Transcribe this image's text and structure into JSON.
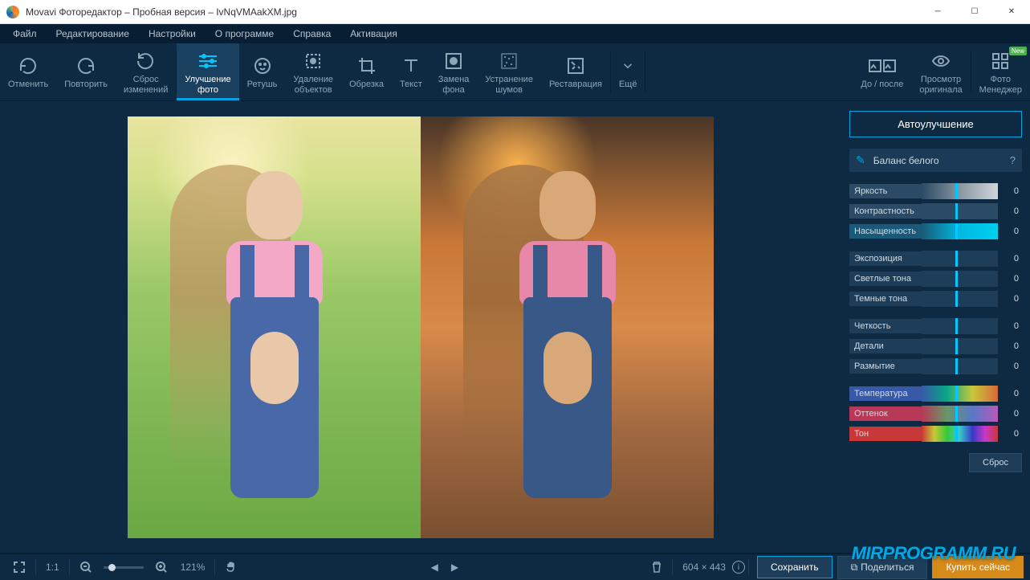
{
  "window": {
    "title": "Movavi Фоторедактор – Пробная версия – IvNqVMAakXM.jpg"
  },
  "menu": {
    "file": "Файл",
    "edit": "Редактирование",
    "settings": "Настройки",
    "about": "О программе",
    "help": "Справка",
    "activation": "Активация"
  },
  "toolbar": {
    "undo": "Отменить",
    "redo": "Повторить",
    "reset": "Сброс\nизменений",
    "enhance": "Улучшение\nфото",
    "retouch": "Ретушь",
    "remove": "Удаление\nобъектов",
    "crop": "Обрезка",
    "text": "Текст",
    "bg": "Замена\nфона",
    "noise": "Устранение\nшумов",
    "restore": "Реставрация",
    "more": "Ещё",
    "beforeafter": "До / после",
    "original": "Просмотр\nоригинала",
    "manager": "Фото\nМенеджер",
    "new_badge": "New"
  },
  "panel": {
    "auto": "Автоулучшение",
    "wb": "Баланс белого",
    "help": "?",
    "sliders": {
      "brightness": {
        "label": "Яркость",
        "value": "0"
      },
      "contrast": {
        "label": "Контрастность",
        "value": "0"
      },
      "saturation": {
        "label": "Насыщенность",
        "value": "0"
      },
      "exposure": {
        "label": "Экспозиция",
        "value": "0"
      },
      "highlights": {
        "label": "Светлые тона",
        "value": "0"
      },
      "shadows": {
        "label": "Темные тона",
        "value": "0"
      },
      "sharpness": {
        "label": "Четкость",
        "value": "0"
      },
      "details": {
        "label": "Детали",
        "value": "0"
      },
      "blur": {
        "label": "Размытие",
        "value": "0"
      },
      "temperature": {
        "label": "Температура",
        "value": "0"
      },
      "tint": {
        "label": "Оттенок",
        "value": "0"
      },
      "hue": {
        "label": "Тон",
        "value": "0"
      }
    },
    "reset": "Сброс"
  },
  "bottom": {
    "fit": "1:1",
    "zoom": "121%",
    "dimensions": "604 × 443",
    "save": "Сохранить",
    "share": "Поделиться",
    "buy": "Купить сейчас"
  },
  "watermark": "MIRPROGRAMM.RU"
}
